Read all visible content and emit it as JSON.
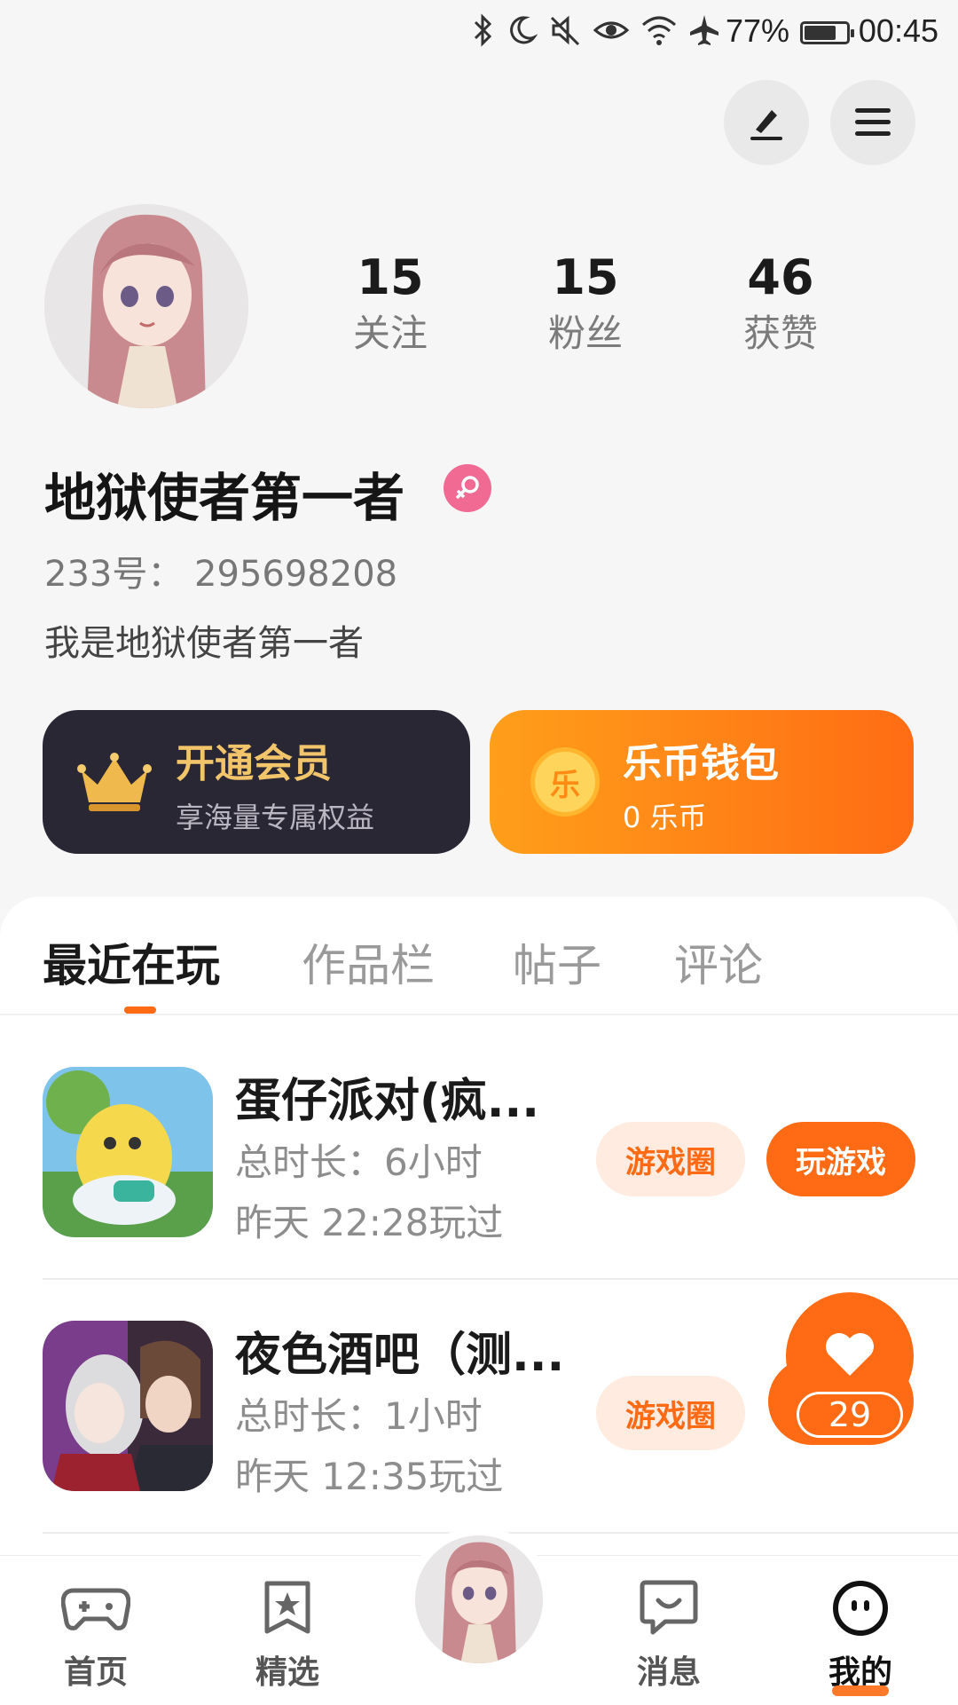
{
  "status_bar": {
    "battery": "77%",
    "time": "00:45",
    "icons": [
      "bluetooth-icon",
      "moon-icon",
      "mute-icon",
      "eye-icon",
      "wifi-icon",
      "airplane-icon",
      "battery-icon"
    ]
  },
  "header": {
    "actions": [
      "edit-icon",
      "menu-icon"
    ]
  },
  "profile": {
    "stats": [
      {
        "value": "15",
        "label": "关注"
      },
      {
        "value": "15",
        "label": "粉丝"
      },
      {
        "value": "46",
        "label": "获赞"
      }
    ],
    "username": "地狱使者第一者",
    "gender_icon": "female-icon",
    "uid": "233号： 295698208",
    "bio": "我是地狱使者第一者"
  },
  "cards": {
    "vip": {
      "title": "开通会员",
      "subtitle": "享海量专属权益",
      "icon": "crown-icon"
    },
    "wallet": {
      "title": "乐币钱包",
      "subtitle": "0 乐币",
      "coin": "乐",
      "icon": "coin-icon"
    }
  },
  "tabs": [
    {
      "label": "最近在玩",
      "active": true
    },
    {
      "label": "作品栏",
      "active": false
    },
    {
      "label": "帖子",
      "active": false
    },
    {
      "label": "评论",
      "active": false
    }
  ],
  "games": [
    {
      "title": "蛋仔派对(疯...",
      "duration": "总时长：6小时",
      "last_played": "昨天 22:28玩过",
      "circle_button": "游戏圈",
      "play_button": "玩游戏"
    },
    {
      "title": "夜色酒吧（测...",
      "duration": "总时长：1小时",
      "last_played": "昨天 12:35玩过",
      "circle_button": "游戏圈"
    }
  ],
  "like_bubble": {
    "count": "29",
    "icon": "heart-icon"
  },
  "bottom_nav": [
    {
      "label": "首页",
      "icon": "gamepad-icon",
      "active": false
    },
    {
      "label": "精选",
      "icon": "star-bookmark-icon",
      "active": false
    },
    {
      "label": "",
      "icon": "avatar",
      "active": false
    },
    {
      "label": "消息",
      "icon": "chat-icon",
      "active": false
    },
    {
      "label": "我的",
      "icon": "face-icon",
      "active": true
    }
  ],
  "colors": {
    "accent": "#ff6a14",
    "vip_card": "#2a2735",
    "vip_gold": "#f3c56b",
    "female_badge": "#f06a93"
  }
}
